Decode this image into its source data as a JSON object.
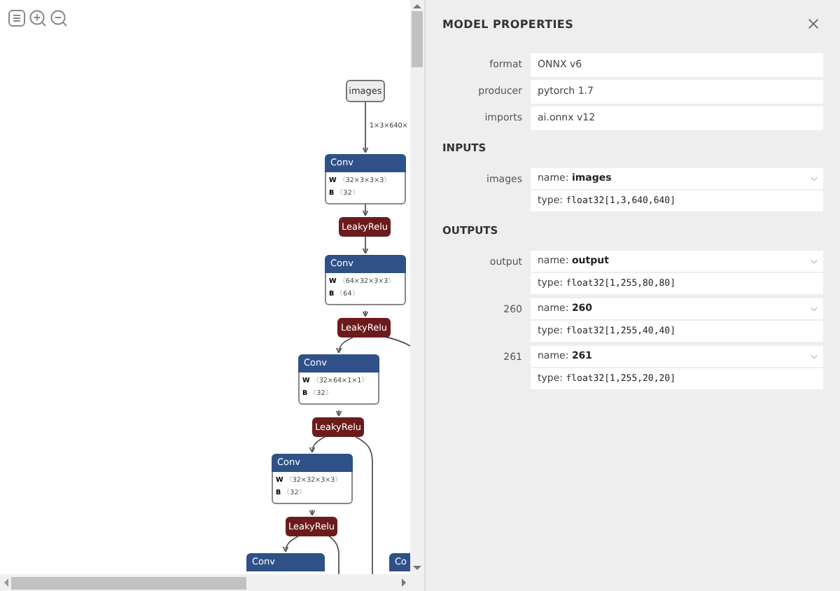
{
  "graph": {
    "nodes": [
      {
        "kind": "input",
        "label": "images"
      },
      {
        "kind": "conv",
        "label": "Conv",
        "attributes": [
          {
            "name": "W",
            "value": "〈32×3×3×3〉"
          },
          {
            "name": "B",
            "value": "〈32〉"
          }
        ]
      },
      {
        "kind": "activation",
        "label": "LeakyRelu"
      },
      {
        "kind": "conv",
        "label": "Conv",
        "attributes": [
          {
            "name": "W",
            "value": "〈64×32×3×3〉"
          },
          {
            "name": "B",
            "value": "〈64〉"
          }
        ]
      },
      {
        "kind": "activation",
        "label": "LeakyRelu"
      },
      {
        "kind": "conv",
        "label": "Conv",
        "attributes": [
          {
            "name": "W",
            "value": "〈32×64×1×1〉"
          },
          {
            "name": "B",
            "value": "〈32〉"
          }
        ]
      },
      {
        "kind": "activation",
        "label": "LeakyRelu"
      },
      {
        "kind": "conv",
        "label": "Conv",
        "attributes": [
          {
            "name": "W",
            "value": "〈32×32×3×3〉"
          },
          {
            "name": "B",
            "value": "〈32〉"
          }
        ]
      },
      {
        "kind": "activation",
        "label": "LeakyRelu"
      },
      {
        "kind": "conv",
        "label": "Conv"
      },
      {
        "kind": "conv",
        "label": "Co"
      }
    ],
    "edge_labels": [
      "1×3×640×"
    ]
  },
  "panel": {
    "title": "MODEL PROPERTIES",
    "properties": [
      {
        "label": "format",
        "value": "ONNX v6"
      },
      {
        "label": "producer",
        "value": "pytorch 1.7"
      },
      {
        "label": "imports",
        "value": "ai.onnx v12"
      }
    ],
    "sections": [
      {
        "title": "INPUTS",
        "arguments": [
          {
            "label": "images",
            "name_label": "name:",
            "name": "images",
            "type_label": "type:",
            "type": "float32[1,3,640,640]"
          }
        ]
      },
      {
        "title": "OUTPUTS",
        "arguments": [
          {
            "label": "output",
            "name_label": "name:",
            "name": "output",
            "type_label": "type:",
            "type": "float32[1,255,80,80]"
          },
          {
            "label": "260",
            "name_label": "name:",
            "name": "260",
            "type_label": "type:",
            "type": "float32[1,255,40,40]"
          },
          {
            "label": "261",
            "name_label": "name:",
            "name": "261",
            "type_label": "type:",
            "type": "float32[1,255,20,20]"
          }
        ]
      }
    ]
  }
}
